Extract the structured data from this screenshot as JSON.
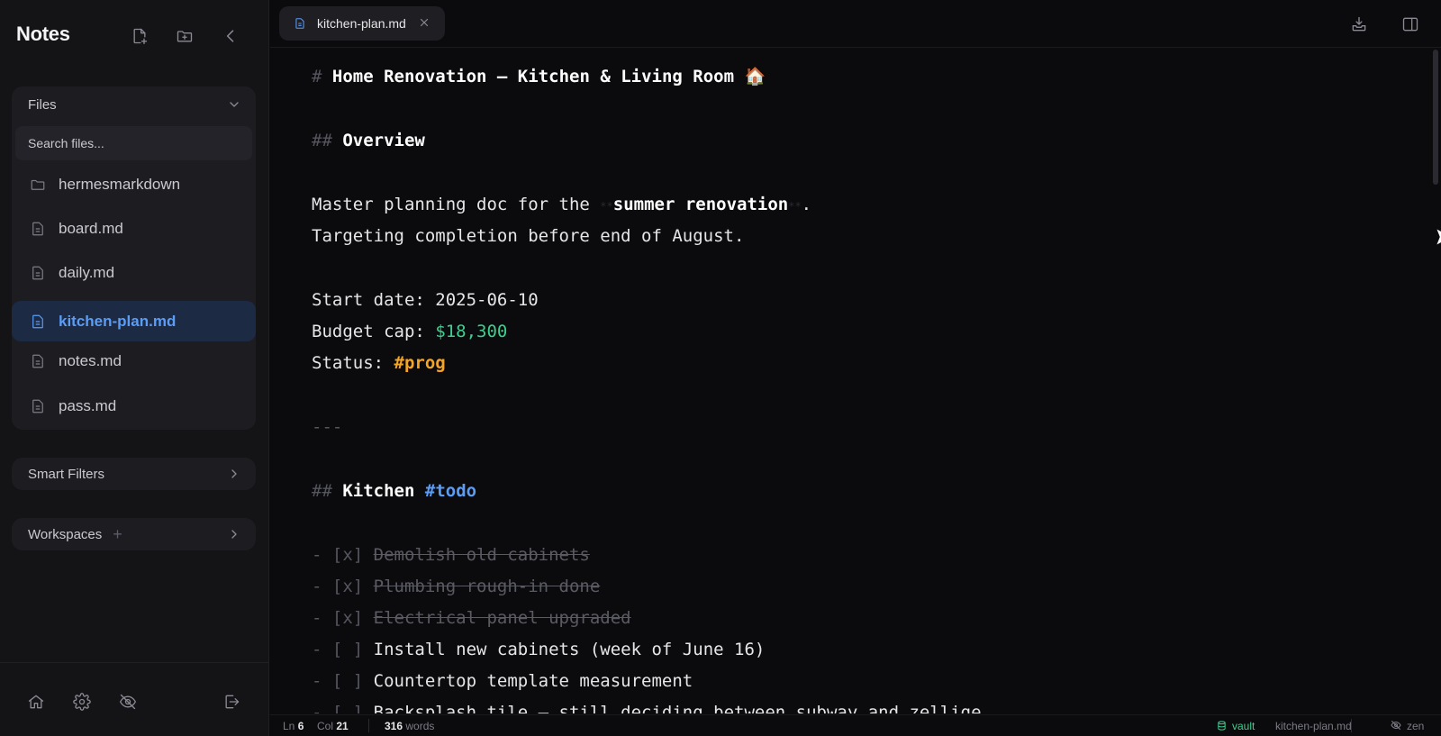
{
  "app": {
    "title": "Notes"
  },
  "sidebar": {
    "files_panel": {
      "title": "Files",
      "search_placeholder": "Search files...",
      "items": [
        {
          "label": "hermesmarkdown",
          "icon": "folder-icon",
          "type": "folder"
        },
        {
          "label": "board.md",
          "icon": "file-icon",
          "type": "file"
        },
        {
          "label": "daily.md",
          "icon": "file-icon",
          "type": "file"
        },
        {
          "label": "kitchen-plan.md",
          "icon": "file-icon",
          "type": "file",
          "active": true
        },
        {
          "label": "notes.md",
          "icon": "file-icon",
          "type": "file"
        },
        {
          "label": "pass.md",
          "icon": "file-icon",
          "type": "file"
        }
      ]
    },
    "smart_filters": {
      "title": "Smart Filters"
    },
    "workspaces": {
      "title": "Workspaces"
    }
  },
  "tabs": [
    {
      "label": "kitchen-plan.md",
      "active": true
    }
  ],
  "editor": {
    "h1_marker": "#",
    "h1_text": "Home Renovation — Kitchen & Living Room 🏠",
    "h2_marker": "##",
    "overview_heading": "Overview",
    "p1_prefix": "Master planning doc for the ",
    "p1_marker_open": "**",
    "p1_bold": "summer renovation",
    "p1_marker_close": "**",
    "p1_suffix": ".",
    "p2": "Targeting completion before end of August.",
    "start_label": "Start date: ",
    "start_value": "2025-06-10",
    "budget_label": "Budget cap: ",
    "budget_value": "$18,300",
    "status_label": "Status: ",
    "status_value": "#prog",
    "hr": "---",
    "kitchen_heading": "Kitchen",
    "kitchen_tag": "#todo",
    "tasks": [
      {
        "prefix": "- [x] ",
        "text": "Demolish old cabinets",
        "done": true
      },
      {
        "prefix": "- [x] ",
        "text": "Plumbing rough-in done",
        "done": true
      },
      {
        "prefix": "- [x] ",
        "text": "Electrical panel upgraded",
        "done": true
      },
      {
        "prefix": "- [ ] ",
        "text": "Install new cabinets (week of June 16)",
        "done": false
      },
      {
        "prefix": "- [ ] ",
        "text": "Countertop template measurement",
        "done": false
      },
      {
        "prefix": "- [ ] ",
        "text": "Backsplash tile — still deciding between subway and zellige",
        "done": false
      }
    ]
  },
  "status_bar": {
    "ln_label": "Ln",
    "ln_value": "6",
    "col_label": "Col",
    "col_value": "21",
    "words_value": "316",
    "words_label": "words",
    "vault_label": "vault",
    "file_label": "kitchen-plan.md",
    "zen_label": "zen"
  },
  "colors": {
    "accent": "#5b9cf5",
    "money": "#3ecf8e",
    "status_tag": "#f5a524",
    "background": "#0b0b0e",
    "sidebar": "#141417"
  }
}
